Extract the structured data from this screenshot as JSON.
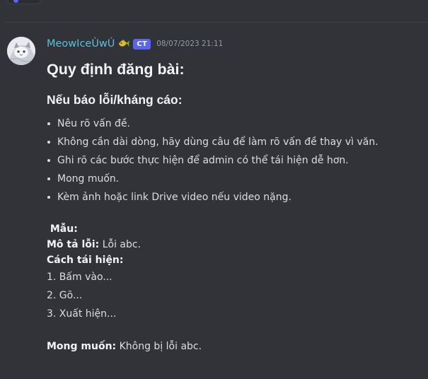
{
  "message": {
    "username": "MeowIceÙwÚ",
    "role_badge": "CT",
    "timestamp": "08/07/2023 21:11",
    "heading": "Quy định đăng bài:",
    "subheading": "Nếu báo lỗi/kháng cáo:",
    "bullets": [
      "Nêu rõ vấn đề.",
      "Không cần dài dòng, hãy dùng câu để làm rõ vấn đề thay vì văn.",
      "Ghi rõ các bước thực hiện để admin có thể tái hiện dễ hơn.",
      "Mong muốn.",
      "Kèm ảnh hoặc link Drive video nếu video nặng."
    ],
    "template": {
      "sample_label": " Mẫu:",
      "description_label": "Mô tả lỗi:",
      "description_value": " Lỗi abc.",
      "repro_label": "Cách tái hiện:",
      "steps": [
        "1. Bấm vào...",
        "2. Gõ...",
        "3. Xuất hiện..."
      ],
      "expected_label": "Mong muốn:",
      "expected_value": " Không bị lỗi abc."
    }
  },
  "colors": {
    "background": "#313338",
    "username": "#5bc0de",
    "badge": "#5865f2",
    "text": "#dbdee1",
    "muted": "#949ba4"
  },
  "icons": {
    "avatar": "cat-avatar-image",
    "role_icon": "fish-role-icon"
  }
}
